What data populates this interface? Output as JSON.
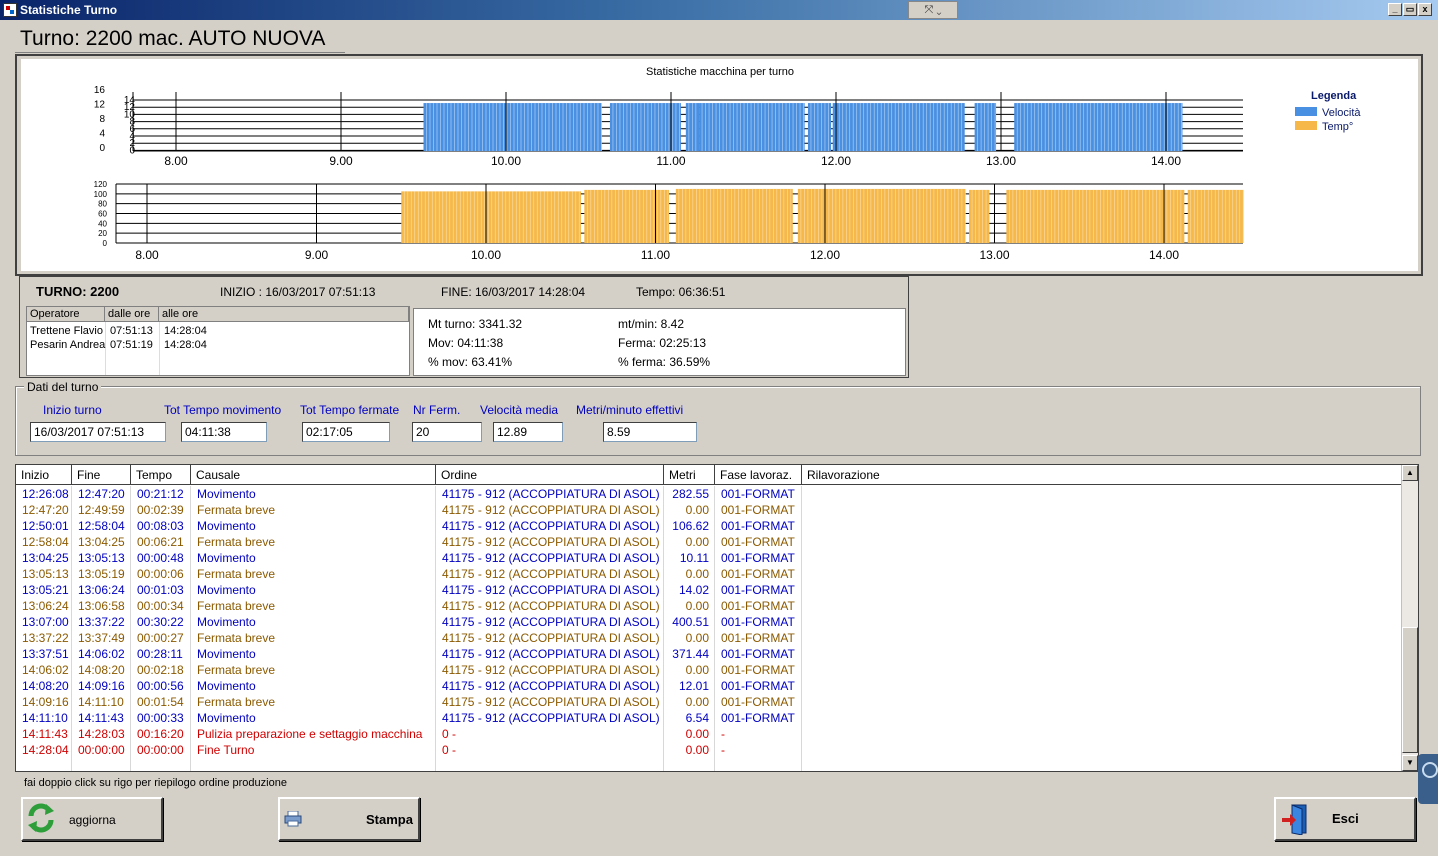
{
  "window": {
    "title": "Statistiche Turno",
    "tools_glyph": "⤧ ⌄",
    "min": "_",
    "max": "▭",
    "close": "x"
  },
  "page_title": "Turno: 2200 mac. AUTO NUOVA",
  "chart_data": [
    {
      "type": "bar",
      "title": "Statistiche macchina per turno",
      "x_ticks": [
        "8.00",
        "9.00",
        "10.00",
        "11.00",
        "12.00",
        "13.00",
        "14.00"
      ],
      "y_ticks": [
        "16",
        "12",
        "8",
        "4",
        "0"
      ],
      "y_ticks_inner": [
        "14",
        "12",
        "10",
        "8",
        "6",
        "4",
        "2",
        "0"
      ],
      "ylim": [
        0,
        16
      ],
      "legend": {
        "title": "Legenda",
        "placement": "right",
        "entries": [
          {
            "name": "Velocità",
            "color": "#4a90e2"
          },
          {
            "name": "Temp°",
            "color": "#f5b849"
          }
        ]
      },
      "series": [
        {
          "name": "Velocità",
          "color": "#4a90e2",
          "segments": [
            {
              "start": 9.5,
              "end": 10.58,
              "value": 13
            },
            {
              "start": 10.63,
              "end": 11.06,
              "value": 13
            },
            {
              "start": 11.09,
              "end": 11.17,
              "value": 13
            },
            {
              "start": 11.17,
              "end": 11.81,
              "value": 13
            },
            {
              "start": 11.83,
              "end": 11.97,
              "value": 13
            },
            {
              "start": 11.98,
              "end": 12.78,
              "value": 13
            },
            {
              "start": 12.84,
              "end": 12.97,
              "value": 13
            },
            {
              "start": 13.08,
              "end": 14.1,
              "value": 13
            }
          ]
        }
      ]
    },
    {
      "type": "bar",
      "x_ticks": [
        "8.00",
        "9.00",
        "10.00",
        "11.00",
        "12.00",
        "13.00",
        "14.00"
      ],
      "y_ticks": [
        "120",
        "100",
        "80",
        "60",
        "40",
        "20",
        "0"
      ],
      "ylim": [
        0,
        120
      ],
      "series": [
        {
          "name": "Temp°",
          "color": "#f5b849",
          "segments": [
            {
              "start": 9.5,
              "end": 10.56,
              "value": 105
            },
            {
              "start": 10.58,
              "end": 11.08,
              "value": 108
            },
            {
              "start": 11.12,
              "end": 11.81,
              "value": 110
            },
            {
              "start": 11.84,
              "end": 12.83,
              "value": 110
            },
            {
              "start": 12.85,
              "end": 12.97,
              "value": 108
            },
            {
              "start": 13.07,
              "end": 14.12,
              "value": 108
            },
            {
              "start": 14.14,
              "end": 14.47,
              "value": 108
            }
          ]
        }
      ]
    }
  ],
  "shift": {
    "turno": "TURNO: 2200",
    "inizio": "INIZIO : 16/03/2017 07:51:13",
    "fine": "FINE: 16/03/2017 14:28:04",
    "tempo": "Tempo: 06:36:51",
    "operators": {
      "headers": [
        "Operatore",
        "dalle ore",
        "alle ore"
      ],
      "rows": [
        [
          "Trettene Flavio",
          "07:51:13",
          "14:28:04"
        ],
        [
          "Pesarin Andrea",
          "07:51:19",
          "14:28:04"
        ]
      ]
    },
    "stats": {
      "mt_turno": "Mt turno: 3341.32",
      "mt_min": "mt/min: 8.42",
      "mov": "Mov: 04:11:38",
      "ferma": "Ferma: 02:25:13",
      "perc_mov": "% mov: 63.41%",
      "perc_ferma": "% ferma: 36.59%"
    }
  },
  "dati_turno": {
    "legend": "Dati del turno",
    "fields": [
      {
        "label": "Inizio turno",
        "value": "16/03/2017 07:51:13"
      },
      {
        "label": "Tot Tempo movimento",
        "value": "04:11:38"
      },
      {
        "label": "Tot Tempo fermate",
        "value": "02:17:05"
      },
      {
        "label": "Nr Ferm.",
        "value": "20"
      },
      {
        "label": "Velocità media",
        "value": "12.89"
      },
      {
        "label": "Metri/minuto effettivi",
        "value": "8.59"
      }
    ]
  },
  "grid": {
    "headers": [
      "Inizio",
      "Fine",
      "Tempo",
      "Causale",
      "Ordine",
      "Metri",
      "Fase lavoraz.",
      "Rilavorazione"
    ],
    "rows": [
      {
        "type": "mov",
        "cells": [
          "12:26:08",
          "12:47:20",
          "00:21:12",
          "Movimento",
          "41175 - 912 (ACCOPPIATURA DI ASOL)",
          "282.55",
          "001-FORMAT",
          ""
        ]
      },
      {
        "type": "fer",
        "cells": [
          "12:47:20",
          "12:49:59",
          "00:02:39",
          "Fermata breve",
          "41175 - 912 (ACCOPPIATURA DI ASOL)",
          "0.00",
          "001-FORMAT",
          ""
        ]
      },
      {
        "type": "mov",
        "cells": [
          "12:50:01",
          "12:58:04",
          "00:08:03",
          "Movimento",
          "41175 - 912 (ACCOPPIATURA DI ASOL)",
          "106.62",
          "001-FORMAT",
          ""
        ]
      },
      {
        "type": "fer",
        "cells": [
          "12:58:04",
          "13:04:25",
          "00:06:21",
          "Fermata breve",
          "41175 - 912 (ACCOPPIATURA DI ASOL)",
          "0.00",
          "001-FORMAT",
          ""
        ]
      },
      {
        "type": "mov",
        "cells": [
          "13:04:25",
          "13:05:13",
          "00:00:48",
          "Movimento",
          "41175 - 912 (ACCOPPIATURA DI ASOL)",
          "10.11",
          "001-FORMAT",
          ""
        ]
      },
      {
        "type": "fer",
        "cells": [
          "13:05:13",
          "13:05:19",
          "00:00:06",
          "Fermata breve",
          "41175 - 912 (ACCOPPIATURA DI ASOL)",
          "0.00",
          "001-FORMAT",
          ""
        ]
      },
      {
        "type": "mov",
        "cells": [
          "13:05:21",
          "13:06:24",
          "00:01:03",
          "Movimento",
          "41175 - 912 (ACCOPPIATURA DI ASOL)",
          "14.02",
          "001-FORMAT",
          ""
        ]
      },
      {
        "type": "fer",
        "cells": [
          "13:06:24",
          "13:06:58",
          "00:00:34",
          "Fermata breve",
          "41175 - 912 (ACCOPPIATURA DI ASOL)",
          "0.00",
          "001-FORMAT",
          ""
        ]
      },
      {
        "type": "mov",
        "cells": [
          "13:07:00",
          "13:37:22",
          "00:30:22",
          "Movimento",
          "41175 - 912 (ACCOPPIATURA DI ASOL)",
          "400.51",
          "001-FORMAT",
          ""
        ]
      },
      {
        "type": "fer",
        "cells": [
          "13:37:22",
          "13:37:49",
          "00:00:27",
          "Fermata breve",
          "41175 - 912 (ACCOPPIATURA DI ASOL)",
          "0.00",
          "001-FORMAT",
          ""
        ]
      },
      {
        "type": "mov",
        "cells": [
          "13:37:51",
          "14:06:02",
          "00:28:11",
          "Movimento",
          "41175 - 912 (ACCOPPIATURA DI ASOL)",
          "371.44",
          "001-FORMAT",
          ""
        ]
      },
      {
        "type": "fer",
        "cells": [
          "14:06:02",
          "14:08:20",
          "00:02:18",
          "Fermata breve",
          "41175 - 912 (ACCOPPIATURA DI ASOL)",
          "0.00",
          "001-FORMAT",
          ""
        ]
      },
      {
        "type": "mov",
        "cells": [
          "14:08:20",
          "14:09:16",
          "00:00:56",
          "Movimento",
          "41175 - 912 (ACCOPPIATURA DI ASOL)",
          "12.01",
          "001-FORMAT",
          ""
        ]
      },
      {
        "type": "fer",
        "cells": [
          "14:09:16",
          "14:11:10",
          "00:01:54",
          "Fermata breve",
          "41175 - 912 (ACCOPPIATURA DI ASOL)",
          "0.00",
          "001-FORMAT",
          ""
        ]
      },
      {
        "type": "mov",
        "cells": [
          "14:11:10",
          "14:11:43",
          "00:00:33",
          "Movimento",
          "41175 - 912 (ACCOPPIATURA DI ASOL)",
          "6.54",
          "001-FORMAT",
          ""
        ]
      },
      {
        "type": "red",
        "cells": [
          "14:11:43",
          "14:28:03",
          "00:16:20",
          "Pulizia preparazione e settaggio macchina",
          "0 -",
          "0.00",
          "-",
          ""
        ]
      },
      {
        "type": "red",
        "cells": [
          "14:28:04",
          "00:00:00",
          "00:00:00",
          "Fine Turno",
          "0 -",
          "0.00",
          "-",
          ""
        ]
      }
    ]
  },
  "hint": "fai doppio click su rigo per riepilogo ordine produzione",
  "buttons": {
    "aggiorna": "aggiorna",
    "stampa": "Stampa",
    "esci": "Esci"
  },
  "colors": {
    "movimento": "#0000c0",
    "fermata": "#8b5a00",
    "pulizia": "#d00000",
    "velocita": "#4a90e2",
    "temp": "#f5b849"
  }
}
